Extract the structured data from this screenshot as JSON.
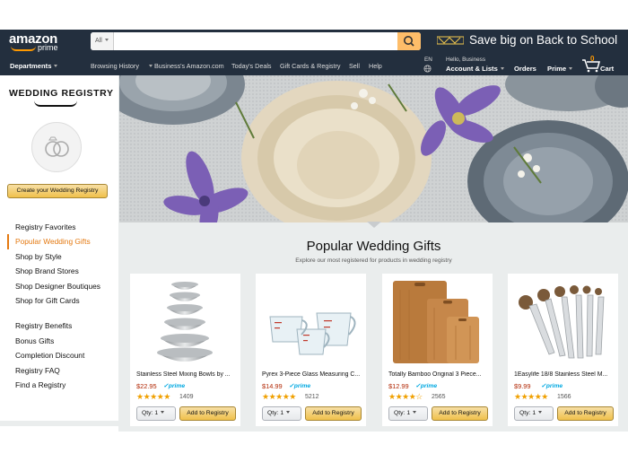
{
  "header": {
    "logo_text": "amazon",
    "logo_sub": "prime",
    "search_category": "All",
    "search_placeholder": "",
    "promo": "Save big on Back to School"
  },
  "nav": {
    "departments": "Departments",
    "links": [
      "Browsing History",
      "Business's Amazon.com",
      "Today's Deals",
      "Gift Cards & Registry",
      "Sell",
      "Help"
    ],
    "language": "EN",
    "account_small": "Hello, Business",
    "account_big": "Account & Lists",
    "orders": "Orders",
    "prime": "Prime",
    "cart_count": "0",
    "cart_label": "Cart"
  },
  "sidebar": {
    "title": "WEDDING REGISTRY",
    "create_button": "Create your Wedding Registry",
    "menu_group1": [
      {
        "label": "Registry Favorites",
        "active": false
      },
      {
        "label": "Popular Wedding Gifts",
        "active": true
      },
      {
        "label": "Shop by Style",
        "active": false
      },
      {
        "label": "Shop Brand Stores",
        "active": false
      },
      {
        "label": "Shop Designer Boutiques",
        "active": false
      },
      {
        "label": "Shop for Gift Cards",
        "active": false
      }
    ],
    "menu_group2": [
      {
        "label": "Registry Benefits"
      },
      {
        "label": "Bonus Gifts"
      },
      {
        "label": "Completion Discount"
      },
      {
        "label": "Registry FAQ"
      },
      {
        "label": "Find a Registry"
      }
    ]
  },
  "section": {
    "title": "Popular Wedding Gifts",
    "subtitle": "Explore our most registered for products in wedding registry"
  },
  "products": [
    {
      "name": "Stainless Steel Mixing Bowls by ...",
      "price": "$22.95",
      "prime": "✓prime",
      "stars": "★★★★★",
      "rating": 4.5,
      "reviews": "1409",
      "qty": "Qty: 1",
      "button": "Add to Registry"
    },
    {
      "name": "Pyrex 3-Piece Glass Measuring C...",
      "price": "$14.99",
      "prime": "✓prime",
      "stars": "★★★★★",
      "rating": 4.5,
      "reviews": "5212",
      "qty": "Qty: 1",
      "button": "Add to Registry"
    },
    {
      "name": "Totally Bamboo Original 3 Piece...",
      "price": "$12.99",
      "prime": "✓prime",
      "stars": "★★★★☆",
      "rating": 4.0,
      "reviews": "2565",
      "qty": "Qty: 1",
      "button": "Add to Registry"
    },
    {
      "name": "1Easylife 18/8 Stainless Steel M...",
      "price": "$9.99",
      "prime": "✓prime",
      "stars": "★★★★★",
      "rating": 5.0,
      "reviews": "1566",
      "qty": "Qty: 1",
      "button": "Add to Registry"
    }
  ],
  "colors": {
    "header_bg": "#232f3e",
    "accent": "#febd69",
    "active_link": "#e47911",
    "price": "#b12704",
    "star": "#f0a000",
    "prime": "#00a8e1"
  }
}
